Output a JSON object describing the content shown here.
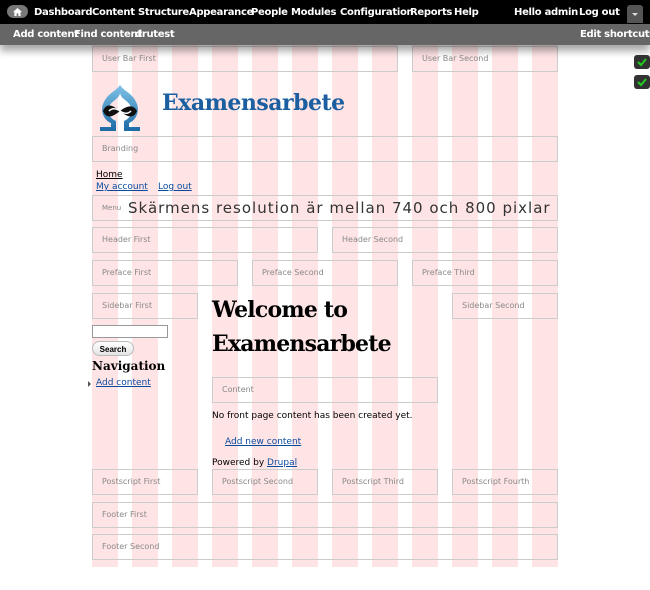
{
  "toolbar": {
    "menu": [
      "Dashboard",
      "Content",
      "Structure",
      "Appearance",
      "People",
      "Modules",
      "Configuration",
      "Reports",
      "Help"
    ],
    "greeting_prefix": "Hello ",
    "greeting_user": "admin",
    "logout": "Log out",
    "shortcuts": [
      "Add content",
      "Find content",
      "drutest"
    ],
    "edit_shortcuts": "Edit shortcuts",
    "icons": {
      "home": "home-icon",
      "toggle": "chevron-down-icon"
    }
  },
  "regions": {
    "user_bar_first": "User Bar First",
    "user_bar_second": "User Bar Second",
    "branding": "Branding",
    "menu": "Menu",
    "header_first": "Header First",
    "header_second": "Header Second",
    "preface_first": "Preface First",
    "preface_second": "Preface Second",
    "preface_third": "Preface Third",
    "sidebar_first": "Sidebar First",
    "sidebar_second": "Sidebar Second",
    "content": "Content",
    "postscript_first": "Postscript First",
    "postscript_second": "Postscript Second",
    "postscript_third": "Postscript Third",
    "postscript_fourth": "Postscript Fourth",
    "footer_first": "Footer First",
    "footer_second": "Footer Second"
  },
  "site": {
    "name": "Examensarbete"
  },
  "links": {
    "home": "Home",
    "my_account": "My account",
    "log_out": "Log out"
  },
  "overlay": {
    "resolution_text": "Skärmens resolution är mellan 740 och 800 pixlar"
  },
  "sidebar": {
    "search_value": "",
    "search_button": "Search",
    "nav_title": "Navigation",
    "nav_items": [
      "Add content"
    ]
  },
  "main": {
    "title": "Welcome to Examensarbete",
    "empty_message": "No front page content has been created yet.",
    "add_new": "Add new content",
    "powered_by": "Powered by ",
    "drupal_link": "Drupal"
  },
  "colors": {
    "grid_stripe": "#ffe4e5",
    "site_name": "#1b5fa0",
    "toolbar_top": "#000000",
    "toolbar_bottom": "#666666",
    "check": "#22cc22"
  }
}
